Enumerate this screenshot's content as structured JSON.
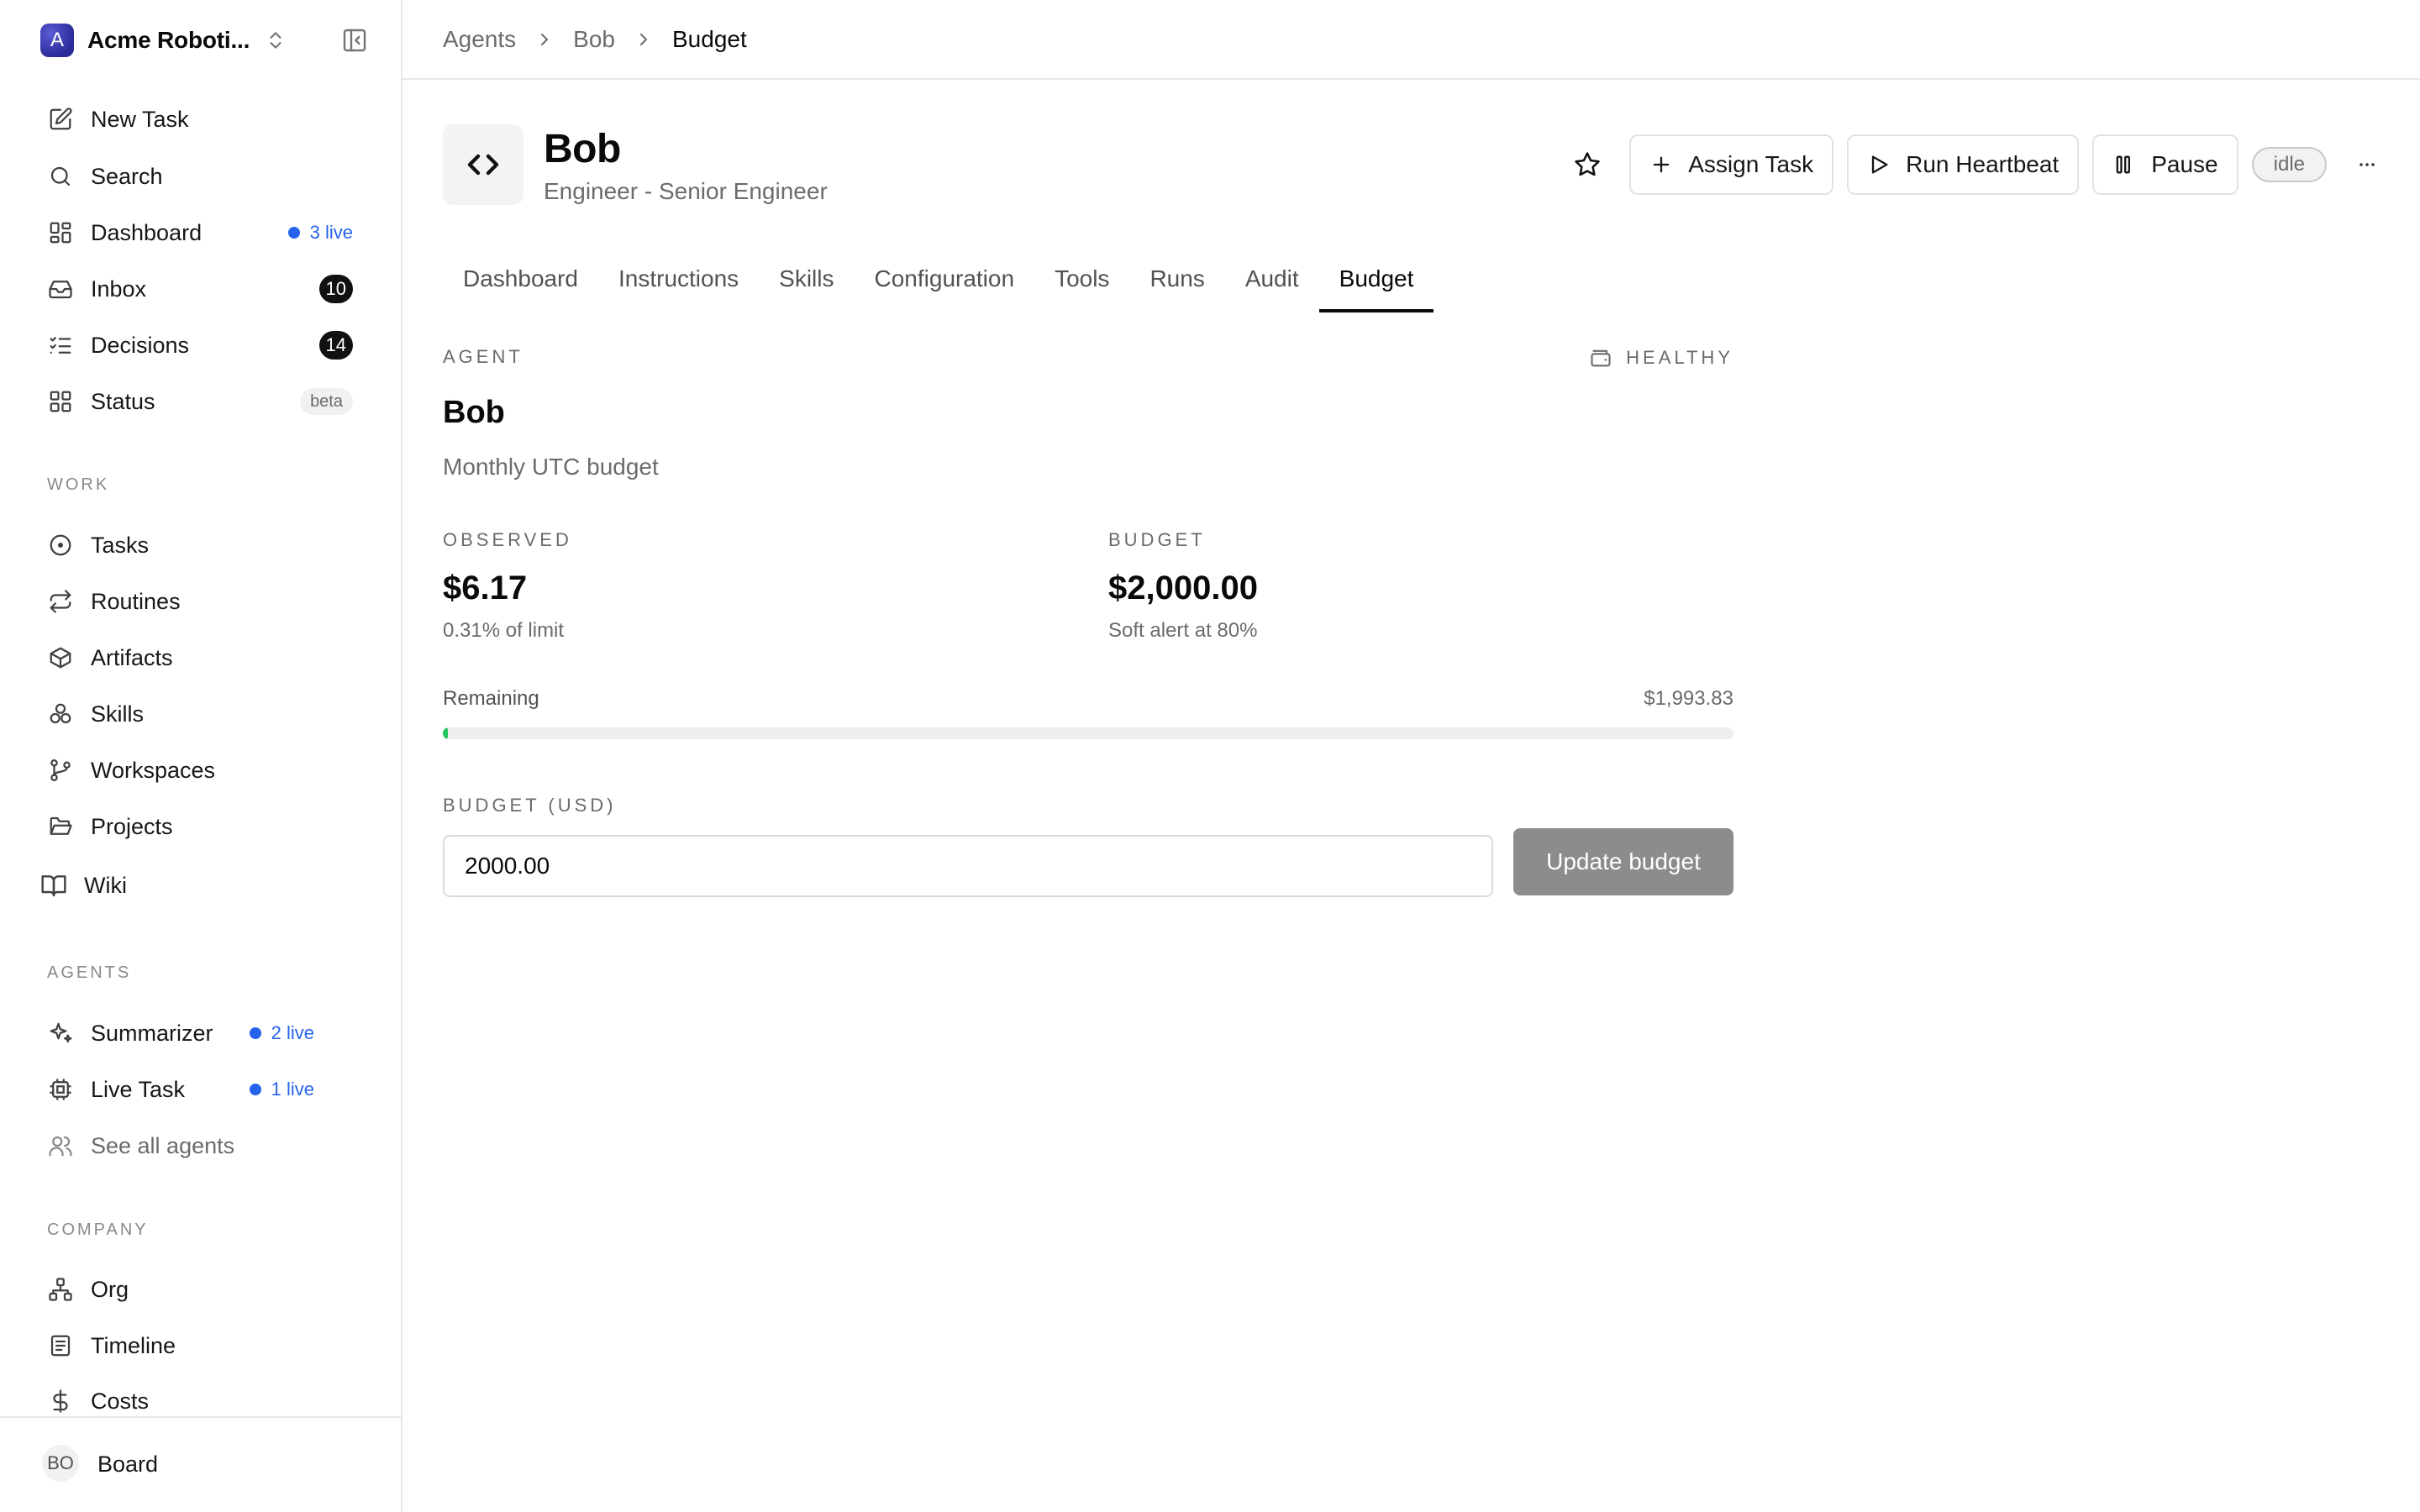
{
  "workspace": {
    "name": "Acme Roboti...",
    "avatar_letter": "A"
  },
  "nav": {
    "new_task": "New Task",
    "search": "Search",
    "dashboard": "Dashboard",
    "dashboard_live": "3 live",
    "inbox": "Inbox",
    "inbox_count": "10",
    "decisions": "Decisions",
    "decisions_count": "14",
    "status": "Status",
    "status_badge": "beta"
  },
  "work": {
    "label": "WORK",
    "items": [
      "Tasks",
      "Routines",
      "Artifacts",
      "Skills",
      "Workspaces",
      "Projects",
      "Wiki"
    ]
  },
  "agents": {
    "label": "AGENTS",
    "summarizer": "Summarizer",
    "summarizer_live": "2 live",
    "live_task": "Live Task",
    "live_task_live": "1 live",
    "see_all": "See all agents"
  },
  "company": {
    "label": "COMPANY",
    "items": [
      "Org",
      "Timeline",
      "Costs"
    ]
  },
  "user": {
    "initials": "BO",
    "name": "Board"
  },
  "breadcrumb": [
    "Agents",
    "Bob",
    "Budget"
  ],
  "agent": {
    "name": "Bob",
    "role": "Engineer - Senior Engineer",
    "status": "idle"
  },
  "actions": {
    "assign": "Assign Task",
    "heartbeat": "Run Heartbeat",
    "pause": "Pause"
  },
  "tabs": [
    "Dashboard",
    "Instructions",
    "Skills",
    "Configuration",
    "Tools",
    "Runs",
    "Audit",
    "Budget"
  ],
  "budget": {
    "kicker": "AGENT",
    "health": "HEALTHY",
    "title": "Bob",
    "subtitle": "Monthly UTC budget",
    "observed_label": "OBSERVED",
    "observed_value": "$6.17",
    "observed_note": "0.31% of limit",
    "budget_label": "BUDGET",
    "budget_value": "$2,000.00",
    "budget_note": "Soft alert at 80%",
    "remaining_label": "Remaining",
    "remaining_value": "$1,993.83",
    "used_percent": 0.31,
    "field_label": "BUDGET (USD)",
    "field_value": "2000.00",
    "update_label": "Update budget"
  },
  "colors": {
    "live": "#2563eb",
    "progress": "#22c55e",
    "update_button": "#8c8c8c"
  }
}
